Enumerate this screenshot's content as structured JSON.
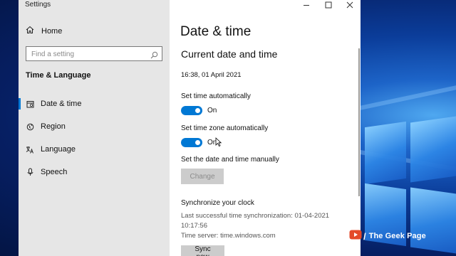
{
  "window": {
    "app_title": "Settings",
    "controls": {
      "minimize": "—",
      "maximize": "☐",
      "close": "✕"
    }
  },
  "sidebar": {
    "home_label": "Home",
    "search_placeholder": "Find a setting",
    "category": "Time & Language",
    "items": [
      {
        "label": "Date & time",
        "icon": "calendar-icon",
        "active": true
      },
      {
        "label": "Region",
        "icon": "globe-icon",
        "active": false
      },
      {
        "label": "Language",
        "icon": "language-icon",
        "active": false
      },
      {
        "label": "Speech",
        "icon": "microphone-icon",
        "active": false
      }
    ]
  },
  "main": {
    "page_title": "Date & time",
    "section_title": "Current date and time",
    "current_datetime": "16:38, 01 April 2021",
    "set_time_auto": {
      "label": "Set time automatically",
      "state": "On",
      "on": true
    },
    "set_timezone_auto": {
      "label": "Set time zone automatically",
      "state": "On",
      "on": true
    },
    "manual": {
      "label": "Set the date and time manually",
      "button": "Change",
      "disabled": true
    },
    "sync": {
      "title": "Synchronize your clock",
      "last_sync_line1": "Last successful time synchronization: 01-04-2021",
      "last_sync_line2": "10:17:56",
      "time_server": "Time server: time.windows.com",
      "button": "Sync now"
    }
  },
  "watermark": {
    "text": "The Geek Page"
  },
  "colors": {
    "accent": "#0078d4",
    "sidebar_bg": "#e6e6e6",
    "button_bg": "#cccccc"
  }
}
